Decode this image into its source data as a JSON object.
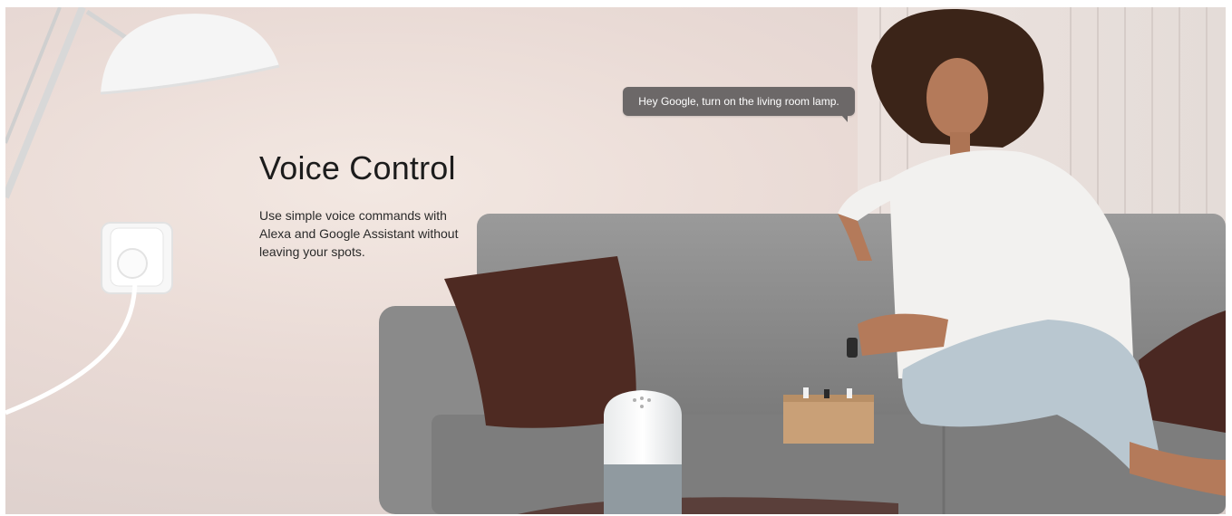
{
  "section": {
    "title": "Voice Control",
    "description": "Use simple voice commands with Alexa and Google Assistant without leaving your spots.",
    "speech_bubble": "Hey Google, turn on the living room lamp."
  },
  "colors": {
    "background": "#e9dad5",
    "sofa": "#8e8e8e",
    "pillow": "#4e2a22",
    "bubble": "#6c6868"
  },
  "icons": [
    "smart-plug-icon",
    "smart-speaker-icon",
    "lamp-icon"
  ]
}
